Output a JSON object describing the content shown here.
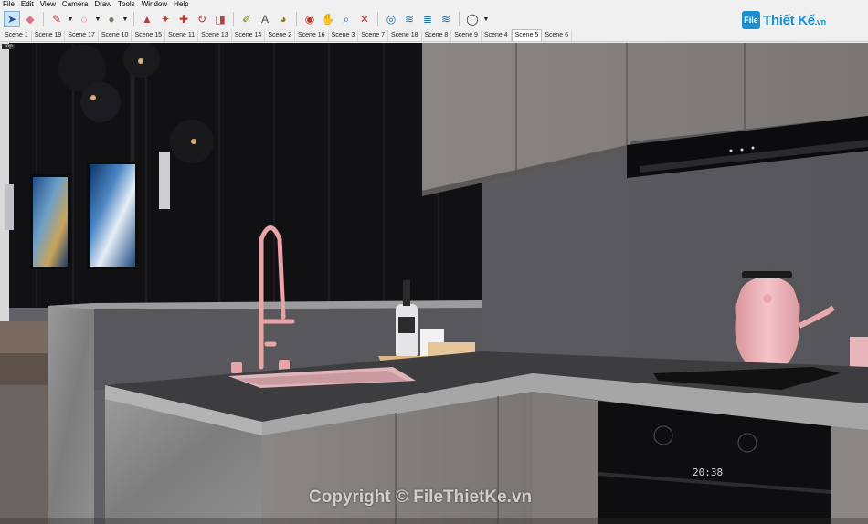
{
  "menu": [
    "File",
    "Edit",
    "View",
    "Camera",
    "Draw",
    "Tools",
    "Window",
    "Help"
  ],
  "toolbar": [
    {
      "icon": "select-arrow-icon",
      "glyph": "➤",
      "color": "#1b4f9c",
      "active": true
    },
    {
      "icon": "eraser-icon",
      "glyph": "◆",
      "color": "#e0708a"
    },
    {
      "icon": "pencil-line-icon",
      "glyph": "✎",
      "color": "#c0392b",
      "dropdown": true
    },
    {
      "icon": "freehand-icon",
      "glyph": "◌",
      "color": "#c0392b",
      "dropdown": true
    },
    {
      "icon": "circle-shape-icon",
      "glyph": "●",
      "color": "#8b7d6b",
      "dropdown": true
    },
    {
      "icon": "push-pull-icon",
      "glyph": "▲",
      "color": "#a94442"
    },
    {
      "icon": "follow-me-icon",
      "glyph": "✦",
      "color": "#c0392b"
    },
    {
      "icon": "move-icon",
      "glyph": "✚",
      "color": "#c0392b"
    },
    {
      "icon": "rotate-icon",
      "glyph": "↻",
      "color": "#c0392b"
    },
    {
      "icon": "scale-icon",
      "glyph": "◨",
      "color": "#a94442"
    },
    {
      "icon": "tape-measure-icon",
      "glyph": "✐",
      "color": "#7a7a20"
    },
    {
      "icon": "dimension-text-icon",
      "glyph": "A",
      "color": "#444444"
    },
    {
      "icon": "paint-bucket-icon",
      "glyph": "◕",
      "color": "#8a7a20"
    },
    {
      "icon": "orbit-icon",
      "glyph": "◉",
      "color": "#c0392b"
    },
    {
      "icon": "pan-hand-icon",
      "glyph": "✋",
      "color": "#b8860b"
    },
    {
      "icon": "zoom-icon",
      "glyph": "⌕",
      "color": "#1b4f9c"
    },
    {
      "icon": "zoom-extents-icon",
      "glyph": "✕",
      "color": "#c0392b"
    },
    {
      "icon": "warehouse-icon",
      "glyph": "◎",
      "color": "#1b6fa8"
    },
    {
      "icon": "extension-warehouse-icon",
      "glyph": "≋",
      "color": "#1b6fa8"
    },
    {
      "icon": "layout-icon",
      "glyph": "≣",
      "color": "#1b6fa8"
    },
    {
      "icon": "extension-manager-icon",
      "glyph": "≋",
      "color": "#1b6fa8"
    },
    {
      "icon": "account-profile-icon",
      "glyph": "◯",
      "color": "#333333",
      "dropdown": true
    }
  ],
  "scenes": [
    "Scene 1",
    "Scene 19",
    "Scene 17",
    "Scene 10",
    "Scene 15",
    "Scene 11",
    "Scene 13",
    "Scene 14",
    "Scene 2",
    "Scene 16",
    "Scene 3",
    "Scene 7",
    "Scene 18",
    "Scene 8",
    "Scene 9",
    "Scene 4",
    "Scene 5",
    "Scene 6"
  ],
  "active_scene": "Scene 5",
  "logo": {
    "mark": "File",
    "name": "Thiết Kế",
    "suffix": ".vn"
  },
  "viewport": {
    "label": "Top",
    "watermark": "Copyright © FileThietKe.vn",
    "oven_display": "20:38"
  },
  "colors": {
    "accent": "#1a8fd0",
    "wall_dark": "#111114",
    "wall_grey": "#5e5e62",
    "cabinet": "#7f7b79",
    "countertop": "#8a8a8a",
    "faucet_pink": "#e8a4a8",
    "kettle_pink": "#f0b5bb"
  }
}
